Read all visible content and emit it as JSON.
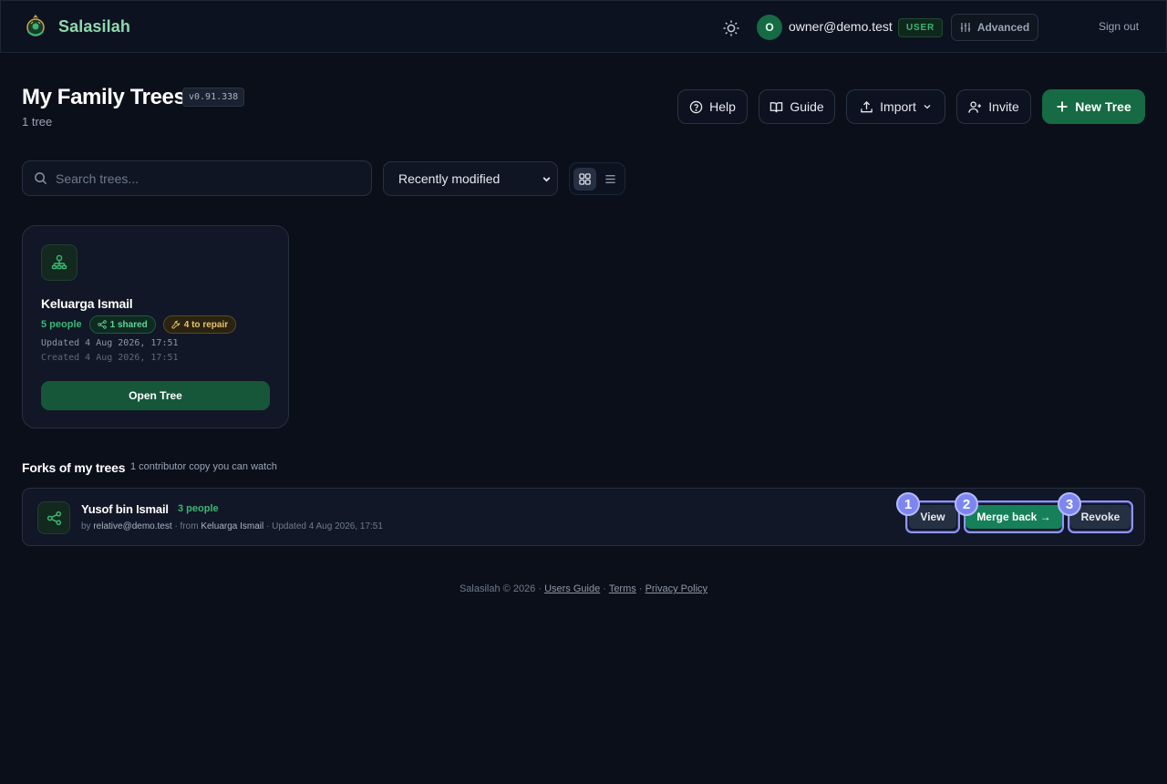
{
  "header": {
    "brand": "Salasilah",
    "user_initial": "O",
    "user_email": "owner@demo.test",
    "role_badge": "USER",
    "advanced_label": "Advanced",
    "signout_label": "Sign out"
  },
  "page": {
    "title": "My Family Trees",
    "version": "v0.91.338",
    "tree_count": "1 tree"
  },
  "actions": {
    "help": "Help",
    "guide": "Guide",
    "import": "Import",
    "invite": "Invite",
    "new_tree": "New Tree"
  },
  "toolbar": {
    "search_placeholder": "Search trees...",
    "sort_selected": "Recently modified",
    "view_mode": "grid"
  },
  "trees": [
    {
      "name": "Keluarga Ismail",
      "people": "5 people",
      "shared": "1 shared",
      "repair": "4 to repair",
      "updated": "Updated 4 Aug 2026, 17:51",
      "created": "Created 4 Aug 2026, 17:51",
      "open_label": "Open Tree"
    }
  ],
  "forks": {
    "title": "Forks of my trees",
    "subtitle": "1 contributor copy you can watch",
    "items": [
      {
        "name": "Yusof bin Ismail",
        "people": "3 people",
        "by_prefix": "by",
        "by_user": "relative@demo.test",
        "from_prefix": "· from",
        "from_tree": "Keluarga Ismail",
        "updated": "· Updated 4 Aug 2026, 17:51",
        "view_label": "View",
        "merge_label": "Merge back →",
        "revoke_label": "Revoke"
      }
    ],
    "step_badges": [
      "1",
      "2",
      "3"
    ]
  },
  "footer": {
    "copyright": "Salasilah © 2026 ·",
    "users_guide": "Users Guide",
    "sep": "·",
    "terms": "Terms",
    "privacy": "Privacy Policy"
  },
  "colors": {
    "background": "#0b0f19",
    "brand_green": "#8fd9ad",
    "primary_button": "#166a44",
    "accent_indigo": "#8e97ff"
  },
  "icons": [
    "logo-icon",
    "sun-icon",
    "sliders-icon",
    "help-circle-icon",
    "book-icon",
    "upload-icon",
    "chevron-down-icon",
    "user-plus-icon",
    "plus-icon",
    "search-icon",
    "grid-icon",
    "list-icon",
    "family-tree-icon",
    "share-icon",
    "tool-icon"
  ]
}
